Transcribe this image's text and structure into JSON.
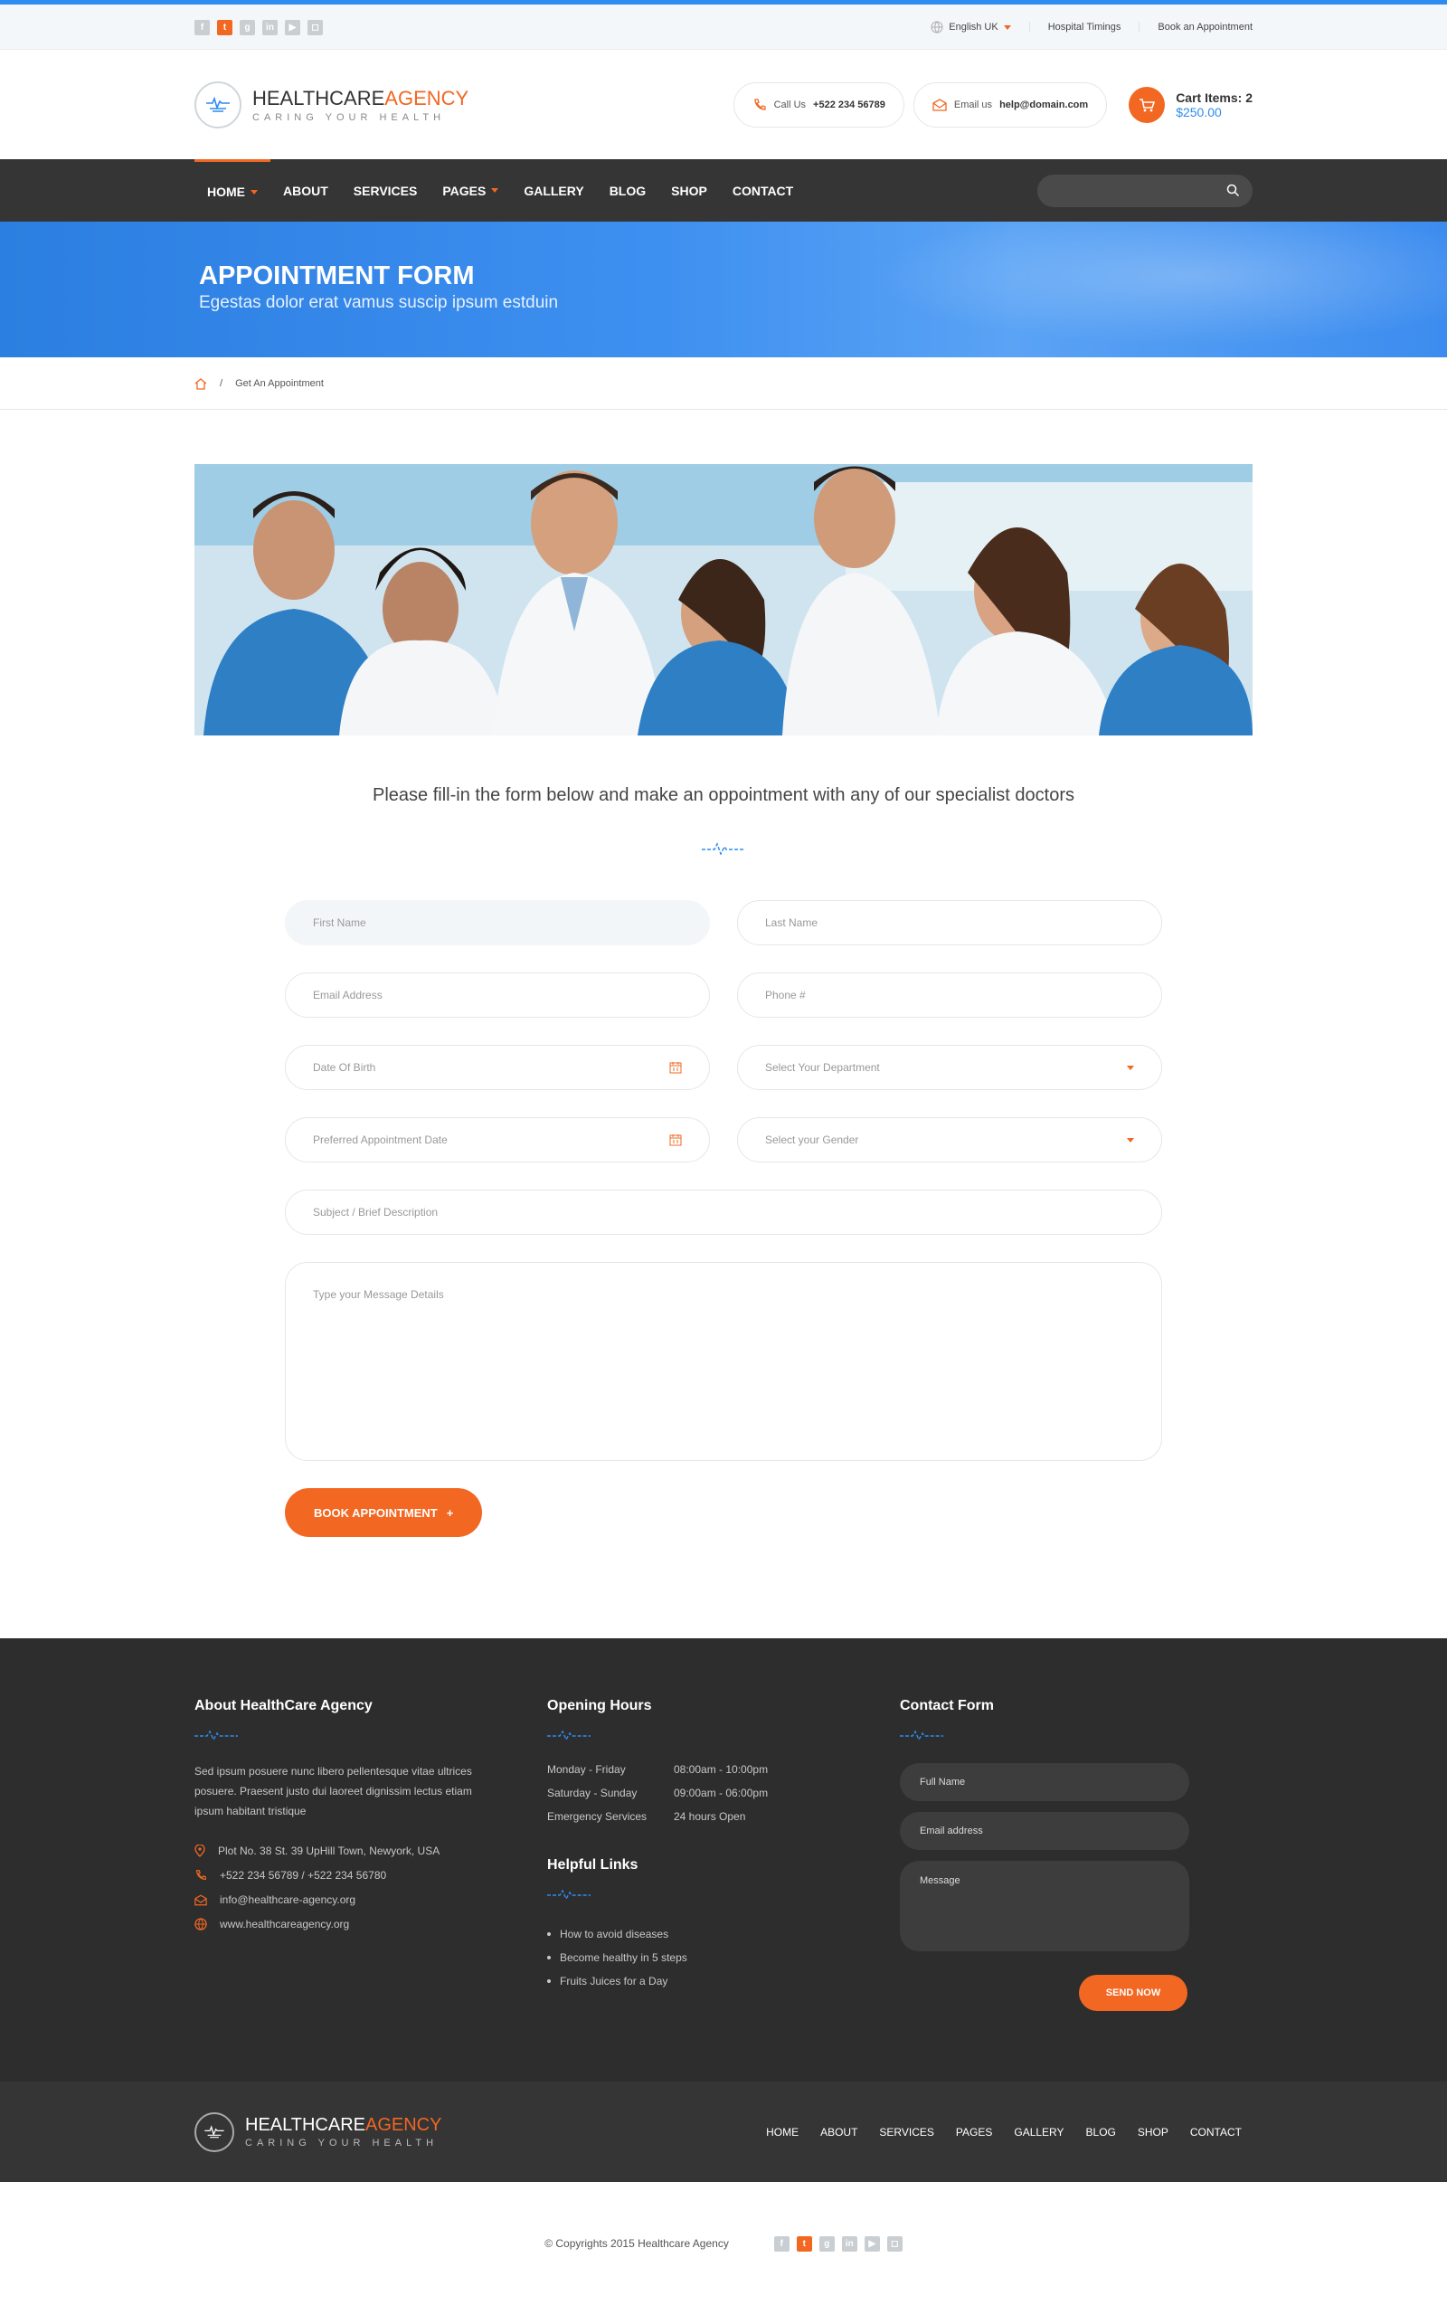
{
  "topbar": {
    "socials": [
      "f",
      "t",
      "g+",
      "in",
      "yt",
      "ig"
    ],
    "language": "English UK",
    "hospital_timings": "Hospital Timings",
    "book_appointment": "Book an Appointment"
  },
  "header": {
    "logo_main": "HEALTHCARE",
    "logo_accent": "AGENCY",
    "logo_tagline": "CARING YOUR HEALTH",
    "call_label": "Call Us",
    "call_number": "+522 234 56789",
    "email_label": "Email us",
    "email_value": "help@domain.com",
    "cart_items": "Cart Items: 2",
    "cart_total": "$250.00"
  },
  "nav": {
    "items": [
      "HOME",
      "ABOUT",
      "SERVICES",
      "PAGES",
      "GALLERY",
      "BLOG",
      "SHOP",
      "CONTACT"
    ]
  },
  "banner": {
    "title": "APPOINTMENT FORM",
    "subtitle": "Egestas dolor erat vamus suscip ipsum estduin"
  },
  "breadcrumb": {
    "separator": "/",
    "current": "Get An Appointment"
  },
  "intro": "Please fill-in the form below and make an oppointment with any of our specialist doctors",
  "form": {
    "first_name": "First Name",
    "last_name": "Last Name",
    "email": "Email Address",
    "phone": "Phone #",
    "dob": "Date Of Birth",
    "department": "Select Your Department",
    "pref_date": "Preferred Appointment Date",
    "gender": "Select your Gender",
    "subject": "Subject  /  Brief Description",
    "message": "Type your Message Details",
    "submit": "BOOK APPOINTMENT",
    "submit_plus": "+"
  },
  "footer": {
    "about_title": "About HealthCare Agency",
    "about_text": "Sed ipsum posuere nunc libero pellentesque vitae ultrices posuere. Praesent justo dui laoreet dignissim lectus etiam ipsum habitant tristique",
    "address": "Plot No. 38 St. 39 UpHill Town, Newyork, USA",
    "phones": "+522 234 56789  / +522 234 56780",
    "email": "info@healthcare-agency.org",
    "website": "www.healthcareagency.org",
    "hours_title": "Opening Hours",
    "hours": [
      {
        "day": "Monday - Friday",
        "time": "08:00am - 10:00pm"
      },
      {
        "day": "Saturday - Sunday",
        "time": "09:00am - 06:00pm"
      },
      {
        "day": "Emergency Services",
        "time": "24 hours Open"
      }
    ],
    "links_title": "Helpful Links",
    "links": [
      "How to avoid diseases",
      "Become healthy in 5 steps",
      "Fruits Juices for a Day"
    ],
    "contact_title": "Contact Form",
    "contact_name": "Full Name",
    "contact_email": "Email address",
    "contact_message": "Message",
    "send": "SEND NOW"
  },
  "footer_bar": {
    "items": [
      "HOME",
      "ABOUT",
      "SERVICES",
      "PAGES",
      "GALLERY",
      "BLOG",
      "SHOP",
      "CONTACT"
    ]
  },
  "copyright": "© Copyrights 2015 Healthcare Agency",
  "colors": {
    "accent": "#f26722",
    "primary": "#2d8cf0",
    "dark": "#2d2d2d"
  }
}
